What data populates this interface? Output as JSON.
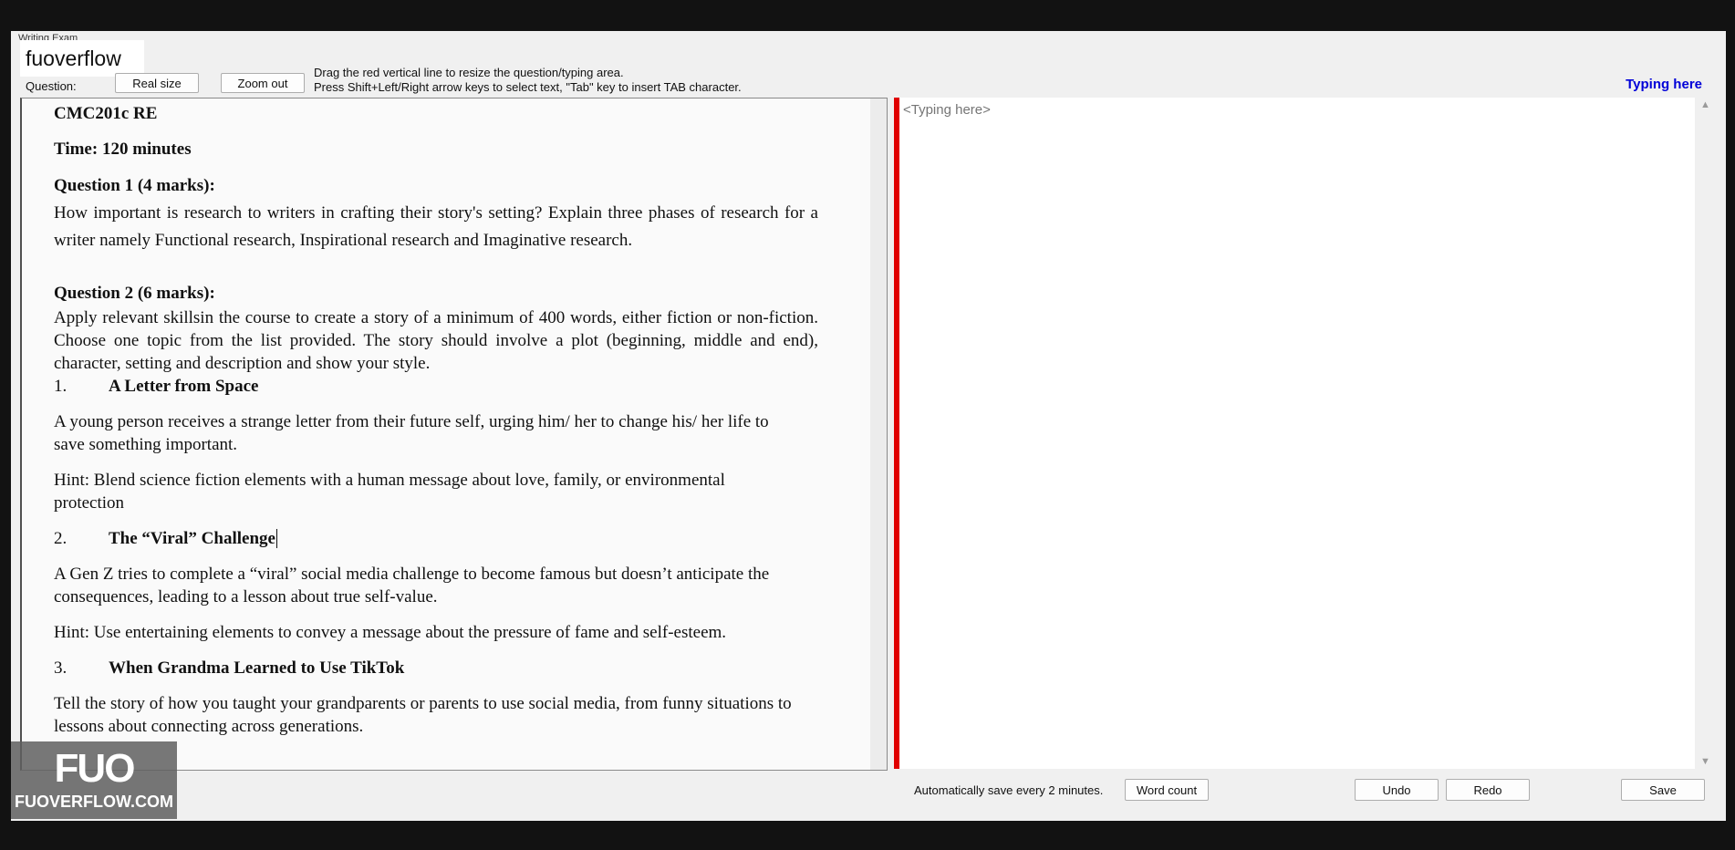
{
  "window": {
    "title_stub": "Writing Exam"
  },
  "brand": {
    "label": "fuoverflow"
  },
  "toolbar": {
    "question_label": "Question:",
    "real_size_label": "Real size",
    "zoom_out_label": "Zoom out",
    "hint_line1": "Drag the red vertical line to resize the question/typing area.",
    "hint_line2": "Press Shift+Left/Right arrow keys to select text, \"Tab\" key to insert TAB character.",
    "typing_here_link": "Typing here"
  },
  "question": {
    "course": "CMC201c RE",
    "time": "Time: 120 minutes",
    "q1_heading": "Question 1 (4 marks):",
    "q1_text": "How important is research to writers in crafting their story's setting? Explain three phases of research for a writer namely Functional research, Inspirational research and Imaginative research.",
    "q2_heading": "Question 2 (6 marks):",
    "q2_text": "Apply relevant skillsin the course to create a story of a minimum of 400 words, either fiction or non-fiction. Choose one topic from the list provided. The story should involve a plot (beginning, middle and end), character, setting and description and show your style.",
    "topics": [
      {
        "num": "1.",
        "title": "A Letter from Space",
        "desc": "A young person receives a strange letter from their future self, urging him/ her to change his/ her life to save something important.",
        "hint": "Hint: Blend science fiction elements with a human message about love, family, or environmental protection"
      },
      {
        "num": "2.",
        "title": "The “Viral” Challenge",
        "desc": "A Gen Z tries to complete a “viral” social media challenge to become famous but doesn’t anticipate the consequences, leading to a lesson about true self-value.",
        "hint": "Hint: Use entertaining elements to convey a message about the pressure of fame and self-esteem."
      },
      {
        "num": "3.",
        "title": "When Grandma Learned to Use TikTok",
        "desc": "Tell the story of how you taught your grandparents or parents to use social media, from funny situations to lessons about connecting across generations."
      }
    ]
  },
  "answer": {
    "placeholder": "<Typing here>",
    "value": ""
  },
  "footer": {
    "autosave_text": "Automatically save every 2 minutes.",
    "word_count_label": "Word count",
    "undo_label": "Undo",
    "redo_label": "Redo",
    "save_label": "Save"
  },
  "watermark": {
    "logo": "FUO",
    "site": "FUOVERFLOW.COM"
  },
  "colors": {
    "splitter": "#e00000",
    "link": "#0000d8",
    "frame": "#f0f0f0"
  }
}
